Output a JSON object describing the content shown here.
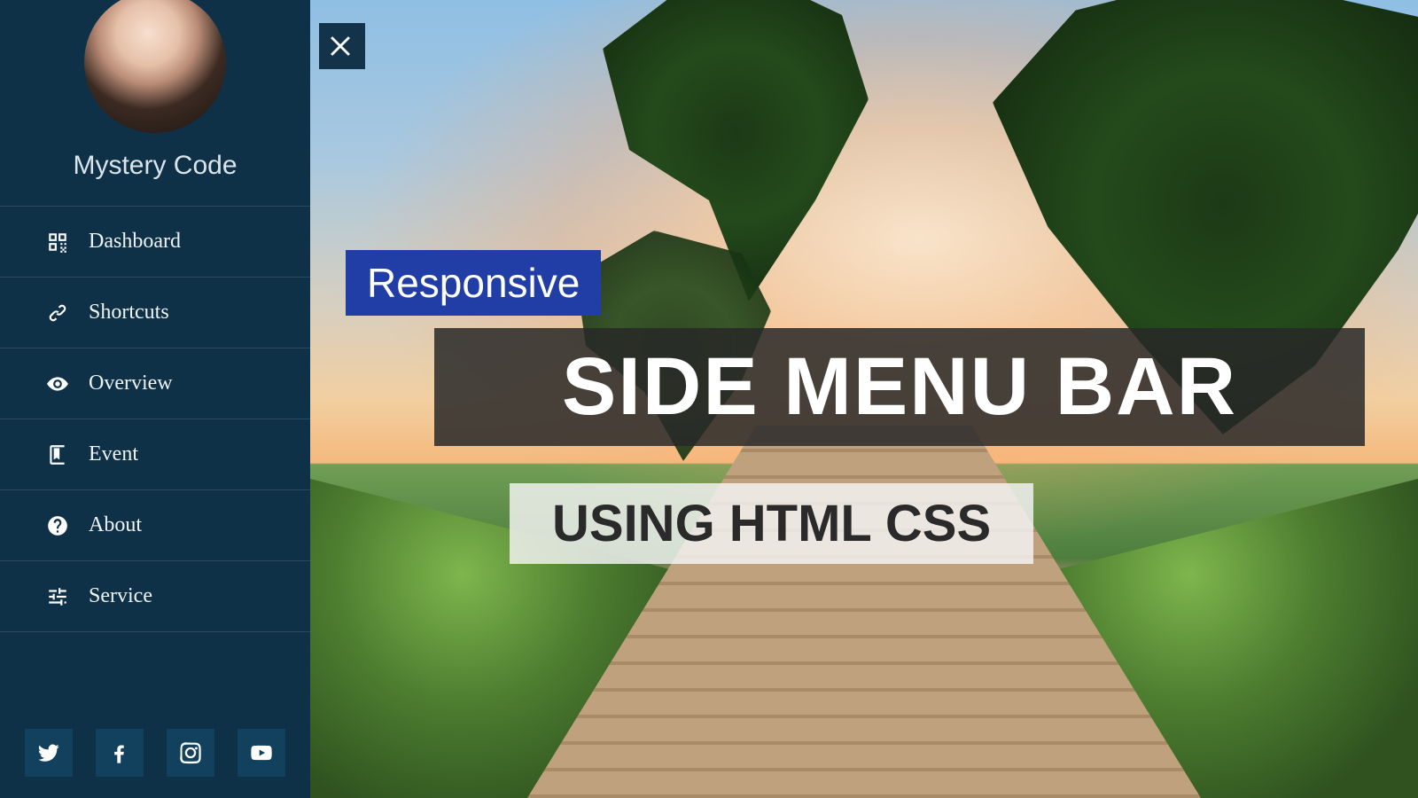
{
  "profile": {
    "name": "Mystery Code"
  },
  "menu": {
    "items": [
      {
        "label": "Dashboard"
      },
      {
        "label": "Shortcuts"
      },
      {
        "label": "Overview"
      },
      {
        "label": "Event"
      },
      {
        "label": "About"
      },
      {
        "label": "Service"
      }
    ]
  },
  "hero": {
    "tag": "Responsive",
    "title": "SIDE MENU BAR",
    "subtitle": "USING HTML CSS"
  },
  "social": {
    "twitter": "twitter",
    "facebook": "facebook",
    "instagram": "instagram",
    "youtube": "youtube"
  }
}
